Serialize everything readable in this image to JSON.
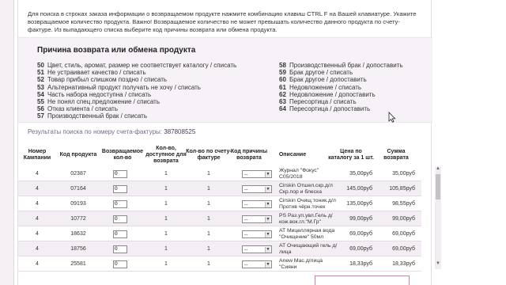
{
  "instruction": "Для поиска в строках заказа информации о возвращаемом продукте нажмите комбинацию клавиш CTRL F на Вашей клавиатуре. Укажите возвращаемое количество продукта. Важно! Возвращаемое количество не может превышать количество данного продукта по счету-фактуре. Из выпадающего списка выберите код причины возврата или обмена продукта.",
  "reasons": {
    "title": "Причина возврата или обмена продукта",
    "left": [
      {
        "code": "50",
        "text": "Цвет, стиль, аромат, размер не соответствует каталогу / списать"
      },
      {
        "code": "51",
        "text": "Не устраивает качество / списать"
      },
      {
        "code": "52",
        "text": "Товар прибыл слишком поздно / списать"
      },
      {
        "code": "53",
        "text": "Альтернативный продукт получать не хочу / списать"
      },
      {
        "code": "54",
        "text": "Часть набора недоступна / списать"
      },
      {
        "code": "55",
        "text": "Не понял спец.предложение / списать"
      },
      {
        "code": "56",
        "text": "Отказ клиента / списать"
      },
      {
        "code": "57",
        "text": "Производственный брак / списать"
      }
    ],
    "right": [
      {
        "code": "58",
        "text": "Производственный брак / допоставить"
      },
      {
        "code": "59",
        "text": "Брак другое / списать"
      },
      {
        "code": "60",
        "text": "Брак другое / допоставить"
      },
      {
        "code": "61",
        "text": "Недовложение / списать"
      },
      {
        "code": "62",
        "text": "Недовложение / допоставить"
      },
      {
        "code": "63",
        "text": "Пересортица / списать"
      },
      {
        "code": "64",
        "text": "Пересортица / допоставить"
      }
    ]
  },
  "search_result": {
    "label": "Результаты поиска по номеру счета-фактуры:",
    "number": "387808525"
  },
  "table": {
    "headers": {
      "campaign": "Номер Кампании",
      "code": "Код продукта",
      "return_qty": "Возвращаемое кол-во",
      "available_qty": "Кол-во, доступное для возврата",
      "invoice_qty": "Кол-во по счету-фактуре",
      "reason_code": "Код причины возврата",
      "description": "Описание",
      "price": "Цена по каталогу за 1 шт.",
      "sum": "Сумма возврата"
    },
    "rows": [
      {
        "campaign": "4",
        "code": "02387",
        "qty": "0",
        "available": "1",
        "invoice": "1",
        "reason": "--",
        "desc1": "Журнал \"Фокус\"",
        "desc2": "С05/2018",
        "price": "35,00руб",
        "sum": "35,00руб"
      },
      {
        "campaign": "4",
        "code": "07164",
        "qty": "0",
        "available": "1",
        "invoice": "1",
        "reason": "--",
        "desc1": "Cirskin Отшел.скр.д/л",
        "desc2": "Скр.пор и блеска",
        "price": "145,00руб",
        "sum": "105,85руб"
      },
      {
        "campaign": "4",
        "code": "09193",
        "qty": "0",
        "available": "1",
        "invoice": "1",
        "reason": "--",
        "desc1": "Cirskin Очищ.тоник.д/л",
        "desc2": "Против чёрн.точек",
        "price": "135,00руб",
        "sum": "98,55руб"
      },
      {
        "campaign": "4",
        "code": "10772",
        "qty": "0",
        "available": "1",
        "invoice": "1",
        "reason": "--",
        "desc1": "PS Раз.уп.увл.Гель д/",
        "desc2": "кож.вок.гл.\"М.Гр\"",
        "price": "99,00руб",
        "sum": "99,00руб"
      },
      {
        "campaign": "4",
        "code": "18632",
        "qty": "0",
        "available": "1",
        "invoice": "1",
        "reason": "--",
        "desc1": "AT Мицеллярная вода",
        "desc2": "\"Очищение\" 50мл",
        "price": "69,00руб",
        "sum": "69,00руб"
      },
      {
        "campaign": "4",
        "code": "18756",
        "qty": "0",
        "available": "1",
        "invoice": "1",
        "reason": "--",
        "desc1": "AT Очищающий гель д/",
        "desc2": "лица",
        "price": "69,00руб",
        "sum": "69,00руб"
      },
      {
        "campaign": "4",
        "code": "25581",
        "qty": "0",
        "available": "1",
        "invoice": "1",
        "reason": "--",
        "desc1": "Anew Мас.д/лица",
        "desc2": "\"Сияни",
        "price": "18,33руб",
        "sum": "18,33руб"
      }
    ]
  }
}
